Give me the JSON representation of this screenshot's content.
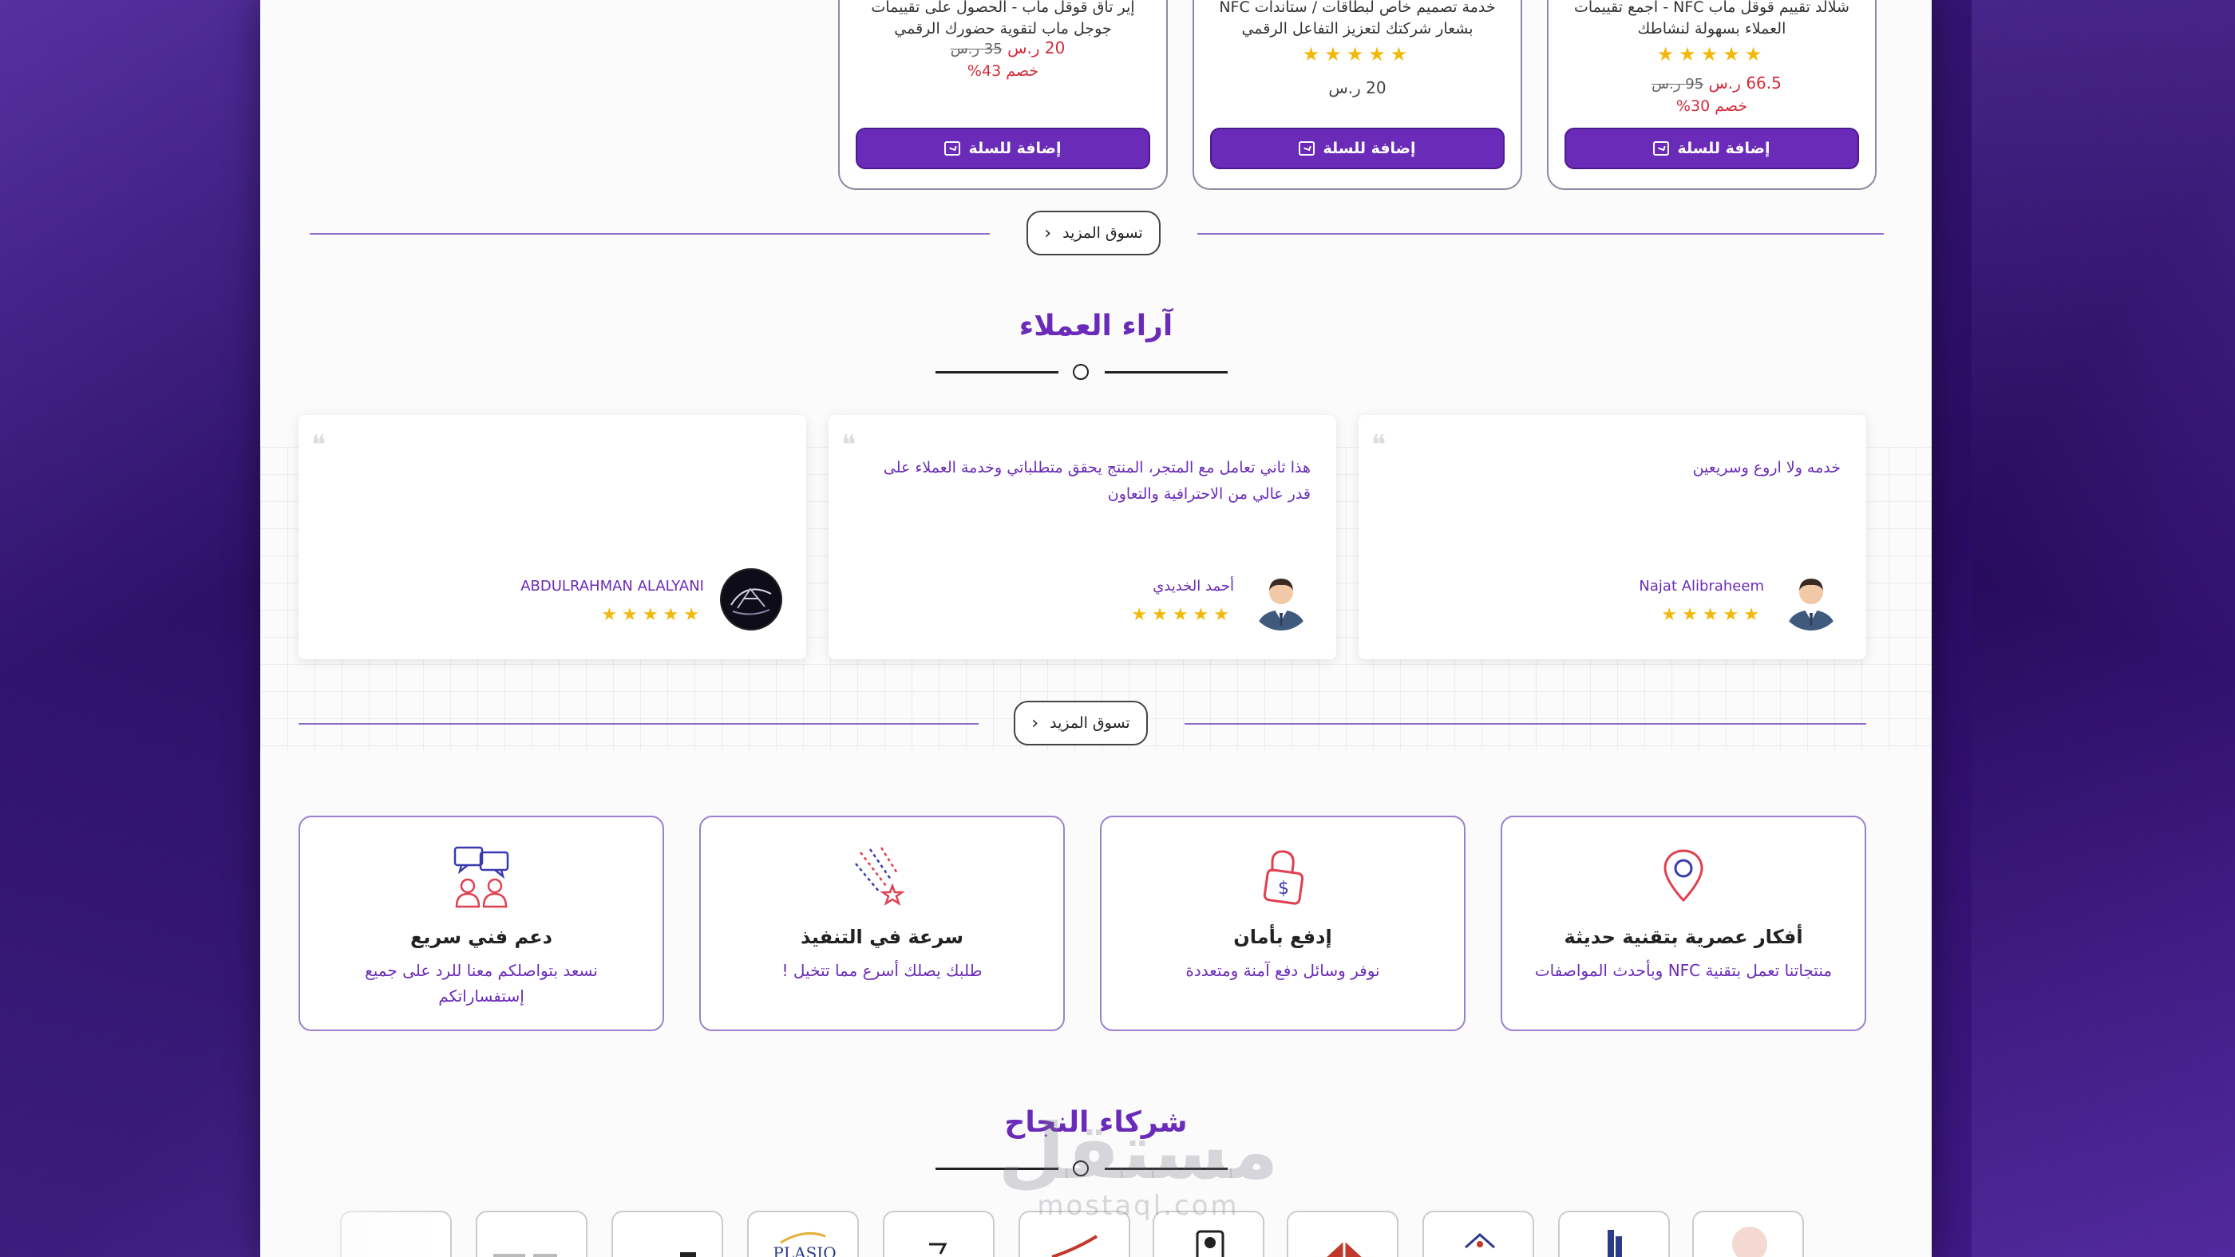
{
  "products": [
    {
      "title": "شلالد تقييم قوقل ماب NFC - اجمع تقييمات العملاء بسهولة لنشاطك",
      "price": "66.5 ر.س",
      "old_price": "95 ر.س",
      "discount": "خصم 30%",
      "rating": 5,
      "stars": "★★★★★",
      "add_to_cart": "إضافة للسلة"
    },
    {
      "title": "خدمة تصميم خاص لبطاقات / ستاندات NFC بشعار شركتك لتعزيز التفاعل الرقمي",
      "price": "20 ر.س",
      "rating": 5,
      "stars": "★★★★★",
      "add_to_cart": "إضافة للسلة"
    },
    {
      "title": "إير تاق قوقل ماب - الحصول على تقييمات جوجل ماب لتقوية حضورك الرقمي",
      "price": "20 ر.س",
      "old_price": "35 ر.س",
      "discount": "خصم 43%",
      "add_to_cart": "إضافة للسلة"
    }
  ],
  "shop_more": "تسوق المزيد",
  "testimonials": {
    "title": "آراء العملاء",
    "items": [
      {
        "text": "خدمه ولا اروع وسريعين",
        "name": "Najat Alibraheem",
        "rating": 5,
        "stars": "★★★★★",
        "avatar": "person-avatar"
      },
      {
        "text": "هذا ثاني تعامل مع المتجر، المنتج يحقق متطلباتي وخدمة العملاء على قدر عالي من الاحترافية والتعاون",
        "name": "أحمد الخديدي",
        "rating": 5,
        "stars": "★★★★★",
        "avatar": "person-avatar"
      },
      {
        "text": "",
        "name": "ABDULRAHMAN ALALYANI",
        "rating": 5,
        "stars": "★★★★★",
        "avatar": "dark-logo-avatar"
      }
    ]
  },
  "features": [
    {
      "icon": "location-pin-icon",
      "title": "أفكار عصرية بتقنية حديثة",
      "desc": "منتجاتنا تعمل بتقنية NFC وبأحدث المواصفات"
    },
    {
      "icon": "secure-payment-lock-icon",
      "title": "إدفع بأمان",
      "desc": "نوفر وسائل دفع آمنة ومتعددة"
    },
    {
      "icon": "shooting-star-icon",
      "title": "سرعة في التنفيذ",
      "desc": "طلبك يصلك أسرع مما تتخيل !"
    },
    {
      "icon": "support-chat-icon",
      "title": "دعم فني سريع",
      "desc": "نسعد بتواصلكم معنا للرد على جميع إستفساراتكم"
    }
  ],
  "partners": {
    "title": "شركاء النجاح",
    "logos": [
      "partner-logo-1",
      "partner-logo-2",
      "partner-logo-3",
      "partner-logo-4",
      "partner-logo-5",
      "partner-logo-6",
      "partner-logo-7",
      "partner-logo-8",
      "partner-logo-9",
      "partner-logo-10"
    ],
    "logo_text": "PLASIO"
  },
  "watermark": {
    "arabic": "مستقل",
    "latin": "mostaql.com"
  },
  "colors": {
    "accent": "#6a2bb8",
    "star": "#f2b90c",
    "discount": "#d42b3b",
    "background": "#2b0e68"
  }
}
